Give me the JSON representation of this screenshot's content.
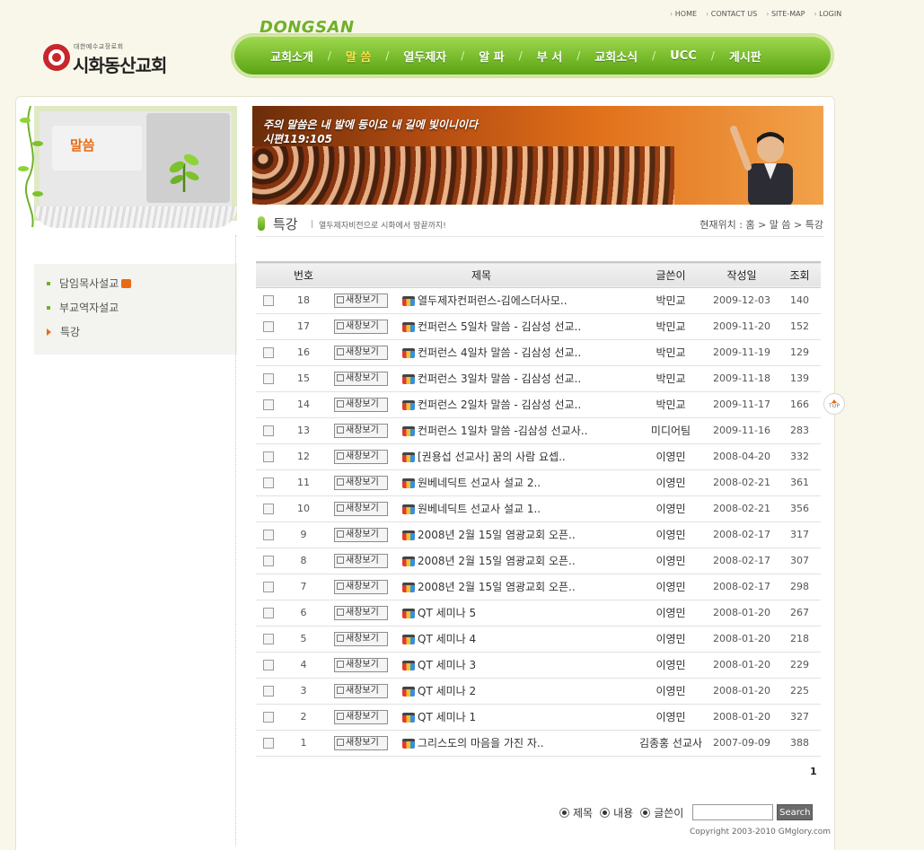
{
  "header": {
    "logo_small": "대한예수교장로회",
    "logo_name": "시화동산교회",
    "brand_tag": "DONGSAN",
    "toplinks": [
      "HOME",
      "CONTACT US",
      "SITE-MAP",
      "LOGIN"
    ],
    "nav": [
      {
        "label": "교회소개",
        "active": false
      },
      {
        "label": "말 씀",
        "active": true
      },
      {
        "label": "열두제자",
        "active": false
      },
      {
        "label": "알 파",
        "active": false
      },
      {
        "label": "부 서",
        "active": false
      },
      {
        "label": "교회소식",
        "active": false
      },
      {
        "label": "UCC",
        "active": false
      },
      {
        "label": "게시판",
        "active": false
      }
    ]
  },
  "sidebar": {
    "title": "말씀",
    "menu": [
      {
        "label": "담임목사설교",
        "new": true,
        "active": false
      },
      {
        "label": "부교역자설교",
        "new": false,
        "active": false
      },
      {
        "label": "특강",
        "new": false,
        "active": true
      }
    ]
  },
  "banner": {
    "verse": "주의 말씀은 내 발에 등이요 내 길에 빛이니이다",
    "reference": "시편119:105"
  },
  "page": {
    "title": "특강",
    "description": "열두제자비전으로 시화에서 땅끝까지!",
    "location": "현재위치 : 홈 > 말 씀 > 특강"
  },
  "board": {
    "columns": {
      "no": "번호",
      "subject": "제목",
      "author": "글쓴이",
      "date": "작성일",
      "views": "조회"
    },
    "newwin_label": "새창보기",
    "rows": [
      {
        "no": "18",
        "subject": "열두제자컨퍼런스-김에스더사모..",
        "author": "박민교",
        "date": "2009-12-03",
        "views": "140"
      },
      {
        "no": "17",
        "subject": "컨퍼런스 5일차 말씀 - 김삼성 선교..",
        "author": "박민교",
        "date": "2009-11-20",
        "views": "152"
      },
      {
        "no": "16",
        "subject": "컨퍼런스 4일차 말씀 - 김삼성 선교..",
        "author": "박민교",
        "date": "2009-11-19",
        "views": "129"
      },
      {
        "no": "15",
        "subject": "컨퍼런스 3일차 말씀 - 김삼성 선교..",
        "author": "박민교",
        "date": "2009-11-18",
        "views": "139"
      },
      {
        "no": "14",
        "subject": "컨퍼런스 2일차 말씀 - 김삼성 선교..",
        "author": "박민교",
        "date": "2009-11-17",
        "views": "166"
      },
      {
        "no": "13",
        "subject": "컨퍼런스 1일차 말씀 -김삼성 선교사..",
        "author": "미디어팀",
        "date": "2009-11-16",
        "views": "283"
      },
      {
        "no": "12",
        "subject": "[권용섭 선교사] 꿈의 사람 요셉..",
        "author": "이영민",
        "date": "2008-04-20",
        "views": "332"
      },
      {
        "no": "11",
        "subject": "원베네딕트 선교사 설교 2..",
        "author": "이영민",
        "date": "2008-02-21",
        "views": "361"
      },
      {
        "no": "10",
        "subject": "원베네딕트 선교사 설교 1..",
        "author": "이영민",
        "date": "2008-02-21",
        "views": "356"
      },
      {
        "no": "9",
        "subject": "2008년 2월 15일 염광교회 오픈..",
        "author": "이영민",
        "date": "2008-02-17",
        "views": "317"
      },
      {
        "no": "8",
        "subject": "2008년 2월 15일 염광교회 오픈..",
        "author": "이영민",
        "date": "2008-02-17",
        "views": "307"
      },
      {
        "no": "7",
        "subject": "2008년 2월 15일 염광교회 오픈..",
        "author": "이영민",
        "date": "2008-02-17",
        "views": "298"
      },
      {
        "no": "6",
        "subject": "QT 세미나 5",
        "author": "이영민",
        "date": "2008-01-20",
        "views": "267"
      },
      {
        "no": "5",
        "subject": "QT 세미나 4",
        "author": "이영민",
        "date": "2008-01-20",
        "views": "218"
      },
      {
        "no": "4",
        "subject": "QT 세미나 3",
        "author": "이영민",
        "date": "2008-01-20",
        "views": "229"
      },
      {
        "no": "3",
        "subject": "QT 세미나 2",
        "author": "이영민",
        "date": "2008-01-20",
        "views": "225"
      },
      {
        "no": "2",
        "subject": "QT 세미나 1",
        "author": "이영민",
        "date": "2008-01-20",
        "views": "327"
      },
      {
        "no": "1",
        "subject": "그리스도의 마음을 가진 자..",
        "author": "김종홍 선교사",
        "date": "2007-09-09",
        "views": "388"
      }
    ]
  },
  "pagination": {
    "current": "1"
  },
  "search": {
    "options": [
      "제목",
      "내용",
      "글쓴이"
    ],
    "value": "",
    "button": "Search"
  },
  "footer": {
    "copyright": "Copyright 2003-2010 GMglory.com"
  },
  "top_button": {
    "label": "TOP"
  },
  "colors": {
    "accent_green": "#6fb12a",
    "accent_orange": "#e96a12",
    "background": "#f9f7ea"
  }
}
